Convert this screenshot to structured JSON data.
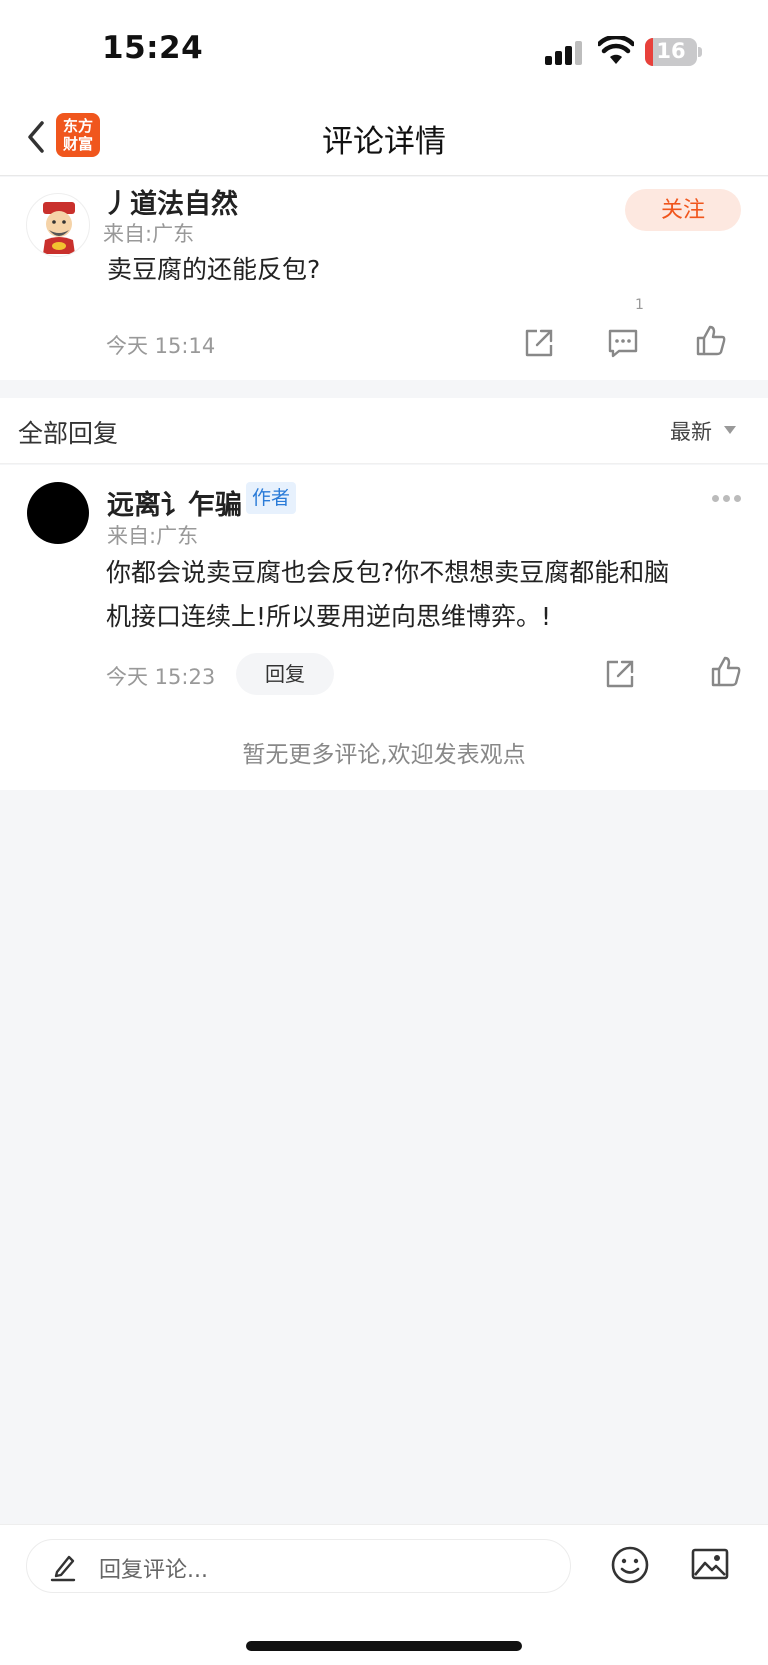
{
  "status_bar": {
    "time": "15:24",
    "battery": "16"
  },
  "nav": {
    "title": "评论详情",
    "logo_line1": "东方",
    "logo_line2": "财富"
  },
  "main_comment": {
    "username": "丿道法自然",
    "location": "来自:广东",
    "content": "卖豆腐的还能反包?",
    "timestamp": "今天 15:14",
    "follow_label": "关注",
    "reply_count": "1"
  },
  "replies_section": {
    "title": "全部回复",
    "sort_label": "最新"
  },
  "reply": {
    "username": "远离讠乍骗",
    "author_tag": "作者",
    "location": "来自:广东",
    "content_line1": "你都会说卖豆腐也会反包?你不想想卖豆腐都能和脑",
    "content_line2": "机接口连续上!所以要用逆向思维博弈。!",
    "timestamp": "今天 15:23",
    "reply_label": "回复"
  },
  "footer_note": "暂无更多评论,欢迎发表观点",
  "bottom_bar": {
    "input_placeholder": "回复评论..."
  },
  "colors": {
    "accent": "#f0561d",
    "follow_bg": "#fde8e0",
    "author_tag_text": "#2a7bd8",
    "author_tag_bg": "#e7f1fd",
    "page_bg": "#f5f6f8"
  }
}
